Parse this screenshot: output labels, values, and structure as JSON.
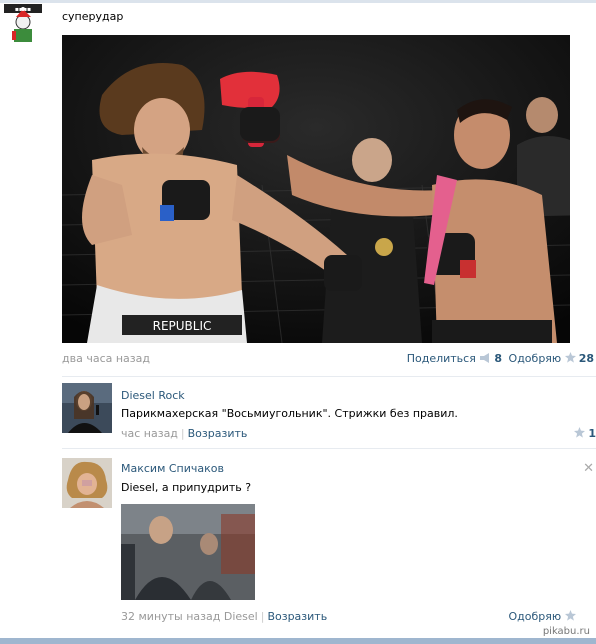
{
  "post": {
    "author_avatar": "cartoon-avatar",
    "text": "суперудар",
    "time": "два часа назад",
    "share_label": "Поделиться",
    "share_count": "8",
    "like_label": "Одобряю",
    "like_count": "28"
  },
  "comments": [
    {
      "name": "Diesel Rock",
      "text": "Парикмахерская \"Восьмиугольник\". Стрижки без правил.",
      "time": "час назад",
      "reply": "Возразить",
      "likes": "1"
    },
    {
      "name": "Максим Спичаков",
      "text": "Diesel, а припудрить ?",
      "time": "32 минуты назад",
      "reply_to": "Diesel",
      "reply": "Возразить",
      "like_label": "Одобряю"
    }
  ],
  "colors": {
    "link": "#2b587a",
    "meta": "#999999",
    "accent": "#9fb6cf"
  },
  "watermark": "pikabu.ru"
}
